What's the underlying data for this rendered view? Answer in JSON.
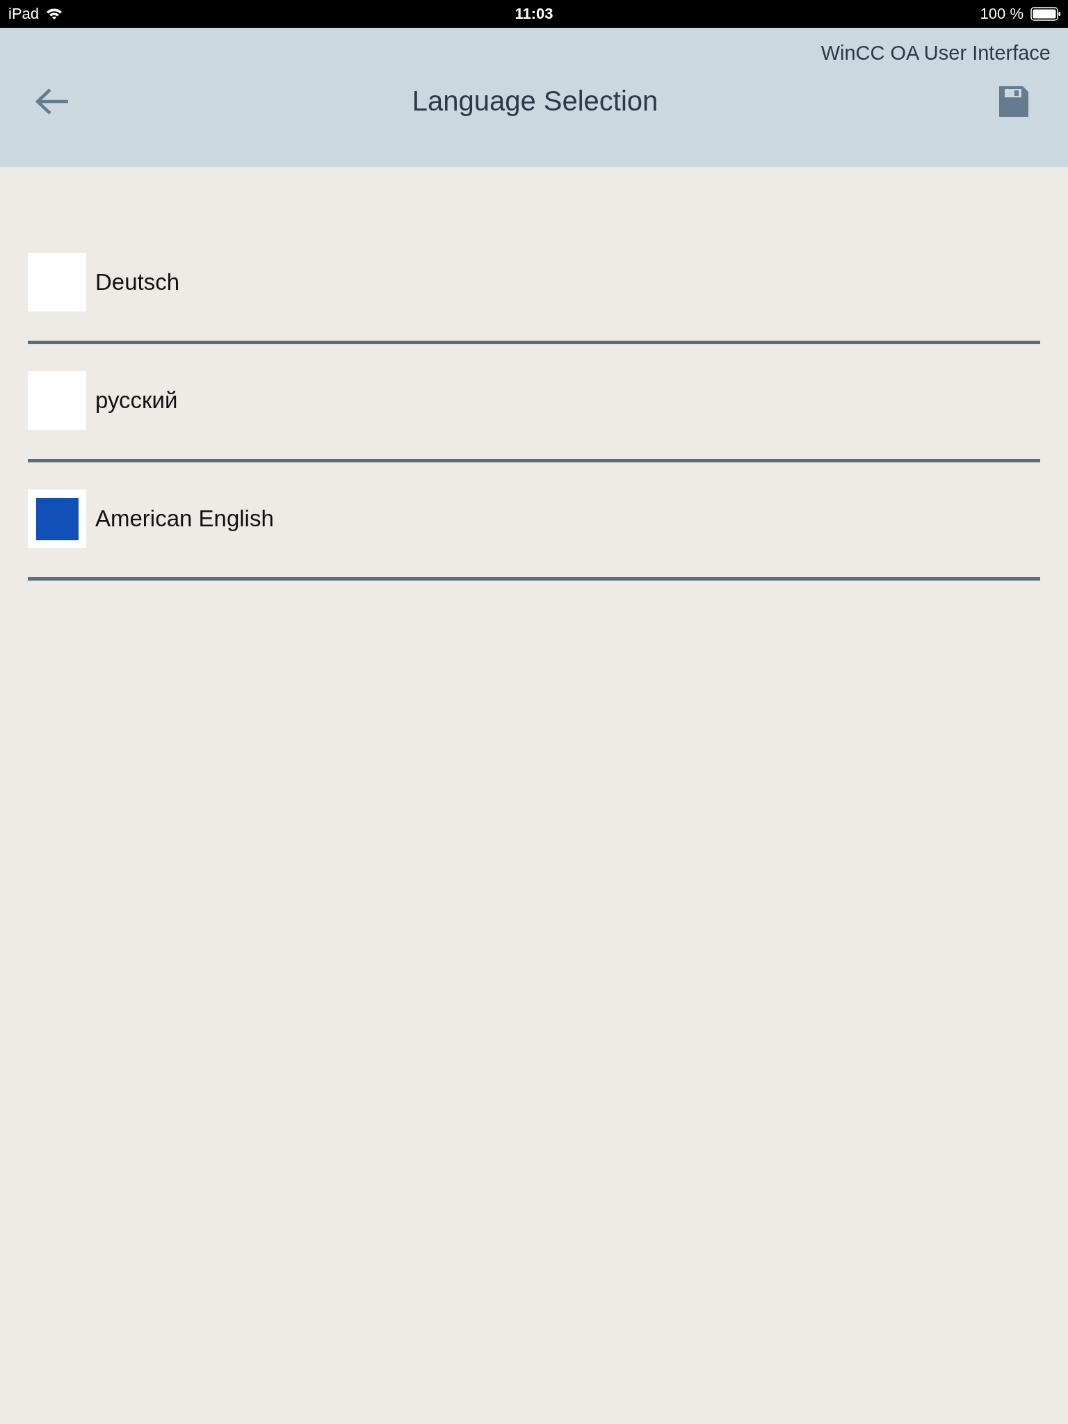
{
  "status_bar": {
    "device": "iPad",
    "time": "11:03",
    "battery": "100 %"
  },
  "header": {
    "app_name": "WinCC OA User Interface",
    "title": "Language Selection"
  },
  "languages": [
    {
      "label": "Deutsch",
      "selected": false
    },
    {
      "label": "русский",
      "selected": false
    },
    {
      "label": "American English",
      "selected": true
    }
  ]
}
